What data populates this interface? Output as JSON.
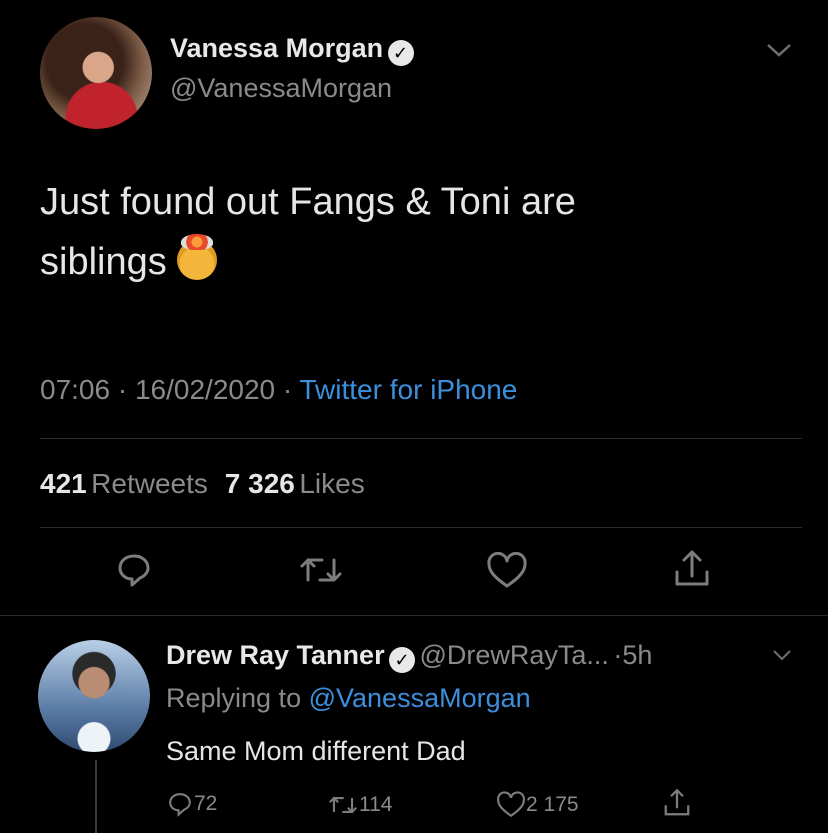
{
  "tweet": {
    "author_name": "Vanessa Morgan",
    "author_handle": "@VanessaMorgan",
    "text_line1": "Just found out Fangs & Toni are",
    "text_line2": "siblings",
    "emoji": "exploding-head-emoji",
    "time": "07:06",
    "date": "16/02/2020",
    "source": "Twitter for iPhone",
    "retweets_count": "421",
    "retweets_label": "Retweets",
    "likes_count": "7 326",
    "likes_label": "Likes"
  },
  "reply": {
    "author_name": "Drew Ray Tanner",
    "author_handle": "@DrewRayTa...",
    "time_ago": "5h",
    "replying_to_label": "Replying to",
    "replying_to_handle": "@VanessaMorgan",
    "text": "Same Mom different Dad",
    "reply_count": "72",
    "retweet_count": "114",
    "like_count": "2 175"
  },
  "icons": {
    "verified": "verified-badge-icon",
    "chevron": "chevron-down-icon",
    "reply": "reply-icon",
    "retweet": "retweet-icon",
    "like": "heart-icon",
    "share": "share-icon"
  },
  "colors": {
    "background": "#000000",
    "link": "#3b8fdc",
    "muted": "#8a8a8a"
  }
}
